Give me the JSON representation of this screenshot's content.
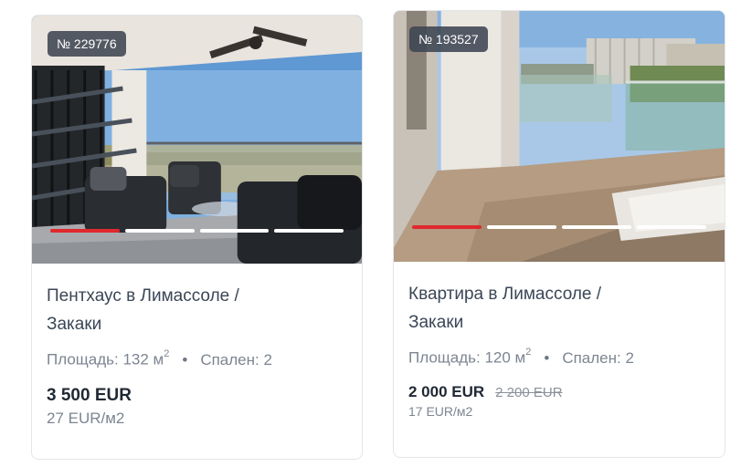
{
  "listings": [
    {
      "badge": "№ 229776",
      "title_line1": "Пентхаус в Лимассоле /",
      "title_line2": "Закаки",
      "area_label": "Площадь: 132 м",
      "area_sup": "2",
      "bullet": "•",
      "bedrooms_label": "Спален: 2",
      "price": "3 500  EUR",
      "price_per_m2": "27  EUR/м2"
    },
    {
      "badge": "№ 193527",
      "title_line1": "Квартира в Лимассоле /",
      "title_line2": "Закаки",
      "area_label": "Площадь: 120 м",
      "area_sup": "2",
      "bullet": "•",
      "bedrooms_label": "Спален: 2",
      "price": "2 000  EUR",
      "price_old": "2 200  EUR",
      "price_per_m2": "17  EUR/м2"
    }
  ],
  "colors": {
    "accent_red": "#e0292e",
    "text_dark": "#1f2833",
    "text_muted": "#7d8591"
  }
}
